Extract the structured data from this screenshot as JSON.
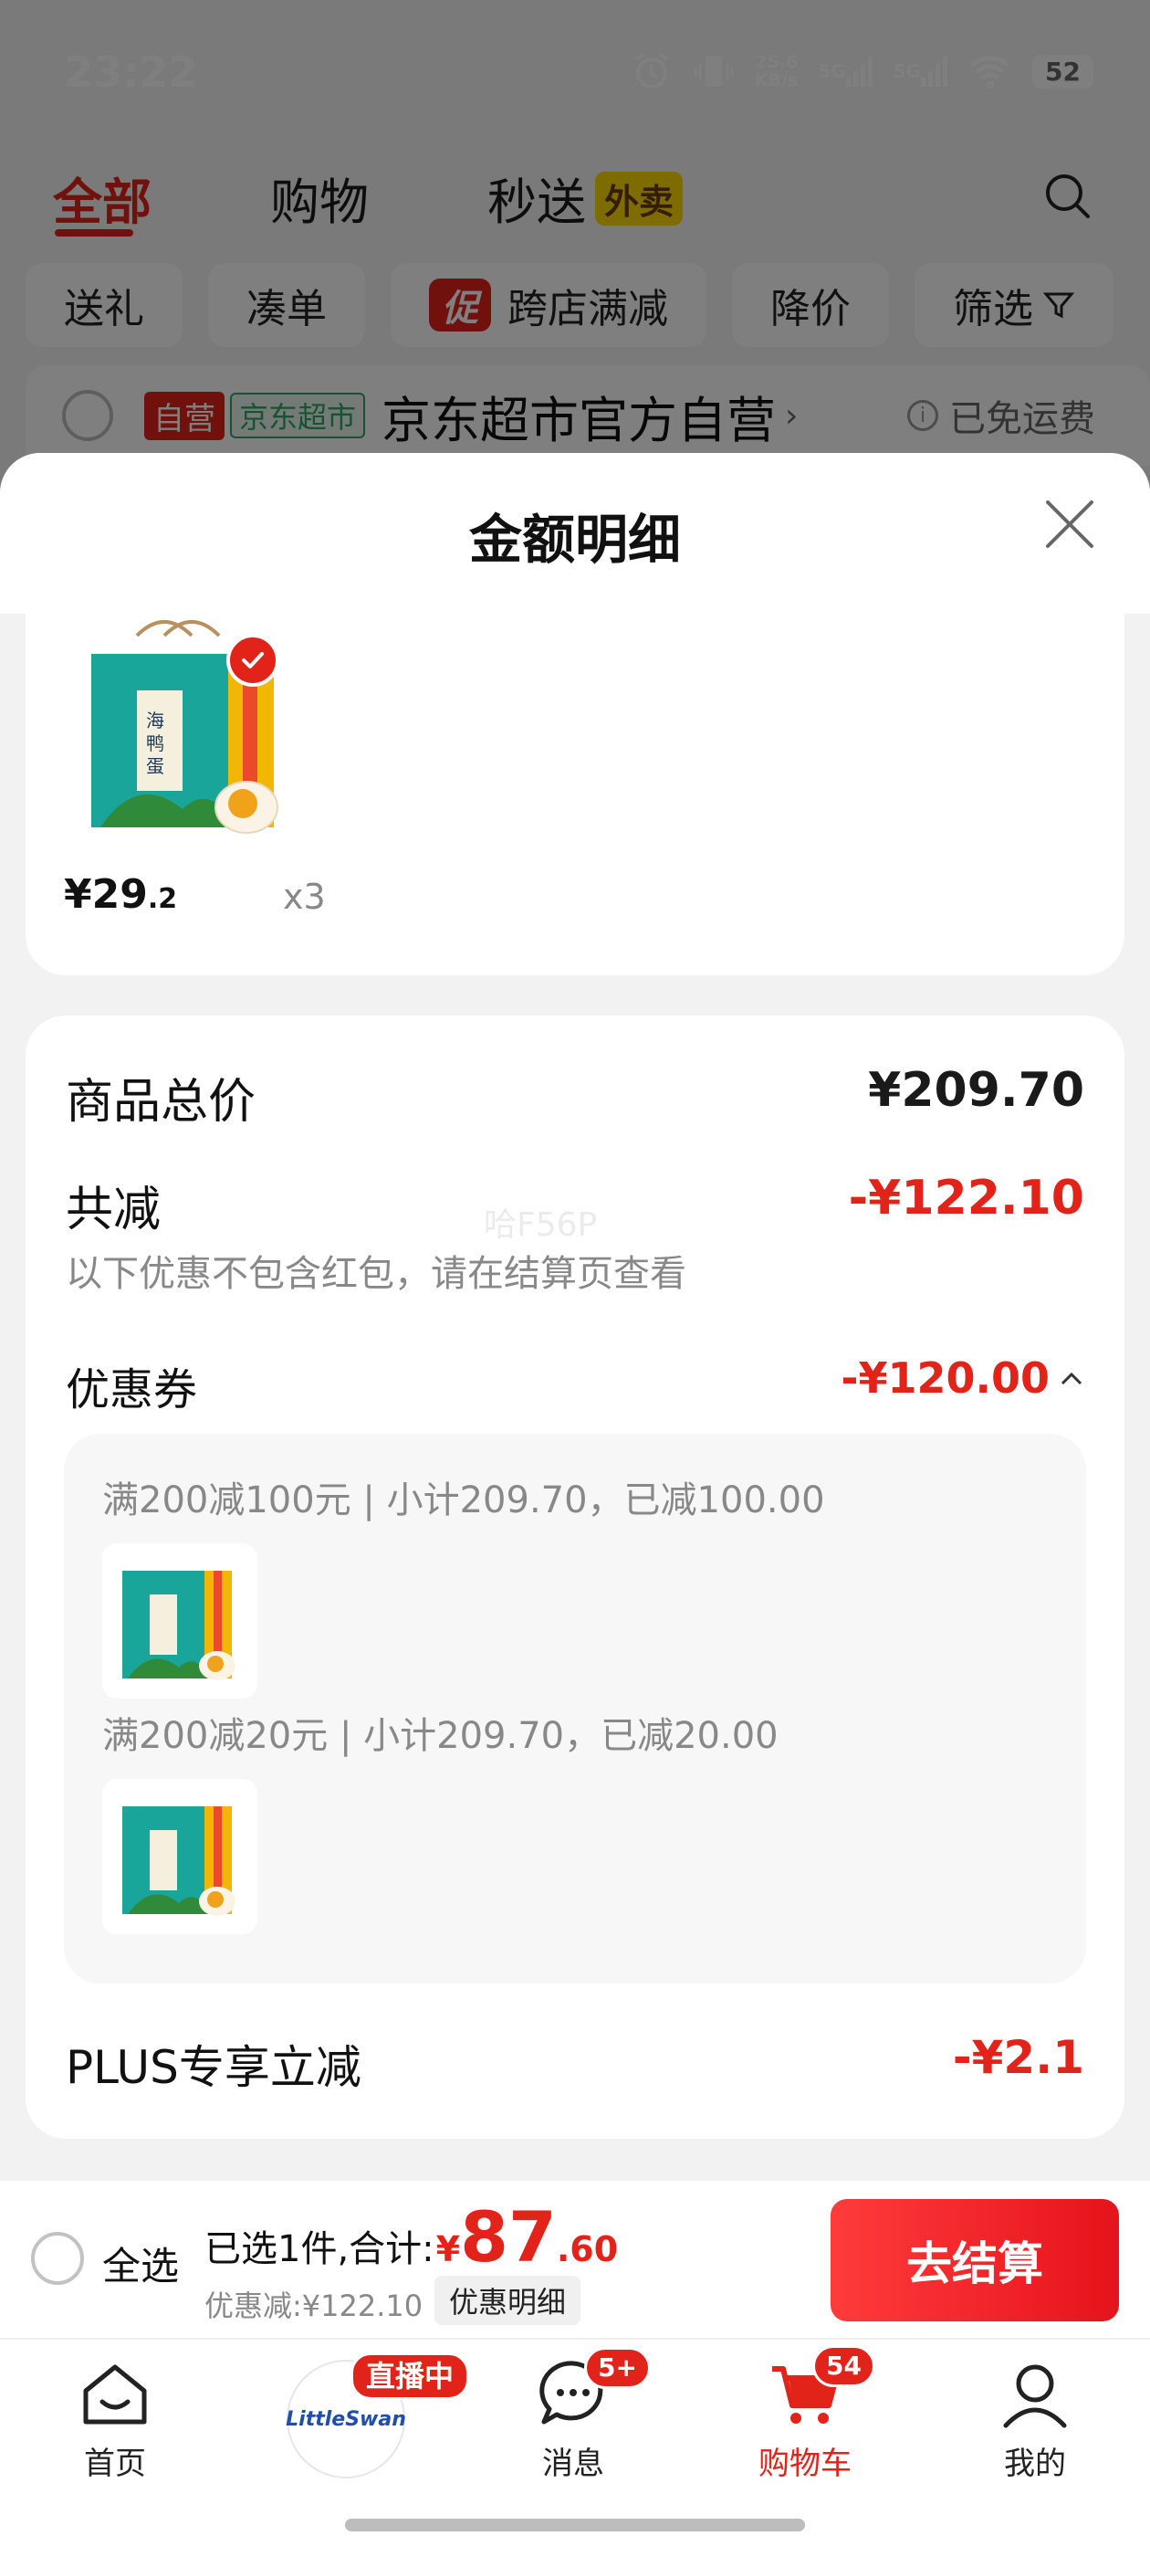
{
  "status_bar": {
    "time": "23:22",
    "net_speed_value": "25.6",
    "net_speed_unit": "KB/s",
    "sim1": "5G",
    "sim2": "5G",
    "battery": "52",
    "icons": [
      "alarm-icon",
      "vibrate-icon",
      "signal-icon",
      "signal-icon",
      "wifi-icon",
      "battery-icon"
    ]
  },
  "top_tabs": {
    "all": "全部",
    "shopping": "购物",
    "express": "秒送",
    "express_badge": "外卖"
  },
  "filters": [
    "送礼",
    "凑单",
    "跨店满减",
    "降价",
    "筛选"
  ],
  "filter_promo_badge": "促",
  "store": {
    "self_tag": "自营",
    "brand_tag": "京东超市",
    "name": "京东超市官方自营",
    "arrow": "›",
    "shipping": "已免运费"
  },
  "sheet": {
    "title": "金额明细"
  },
  "product": {
    "price_int": "¥29",
    "price_dec": ".2",
    "qty": "x3"
  },
  "summary": {
    "total_label": "商品总价",
    "total_value": "¥209.70",
    "reduce_label": "共减",
    "reduce_value": "-¥122.10",
    "reduce_note": "以下优惠不包含红包，请在结算页查看",
    "watermark": "哈F56P",
    "coupon_label": "优惠券",
    "coupon_value": "-¥120.00",
    "coupons": [
      {
        "text": "满200减100元 | 小计209.70，已减100.00"
      },
      {
        "text": "满200减20元 | 小计209.70，已减20.00"
      }
    ],
    "plus_label": "PLUS专享立减",
    "plus_value": "-¥2.1"
  },
  "checkout": {
    "select_all": "全选",
    "selected_text": "已选1件,合计:",
    "yen": "¥",
    "total_int": "87",
    "total_dec": ".60",
    "discount_text": "优惠减:¥122.10",
    "detail_chip": "优惠明细",
    "button": "去结算"
  },
  "tab_bar": {
    "home": "首页",
    "live_badge": "直播中",
    "live_logo": "LittleSwan",
    "messages": "消息",
    "messages_badge": "5+",
    "cart": "购物车",
    "cart_badge": "54",
    "mine": "我的"
  },
  "colors": {
    "accent": "#e2231a",
    "brand_green": "#2fa763",
    "badge_yellow": "#ffd800"
  }
}
